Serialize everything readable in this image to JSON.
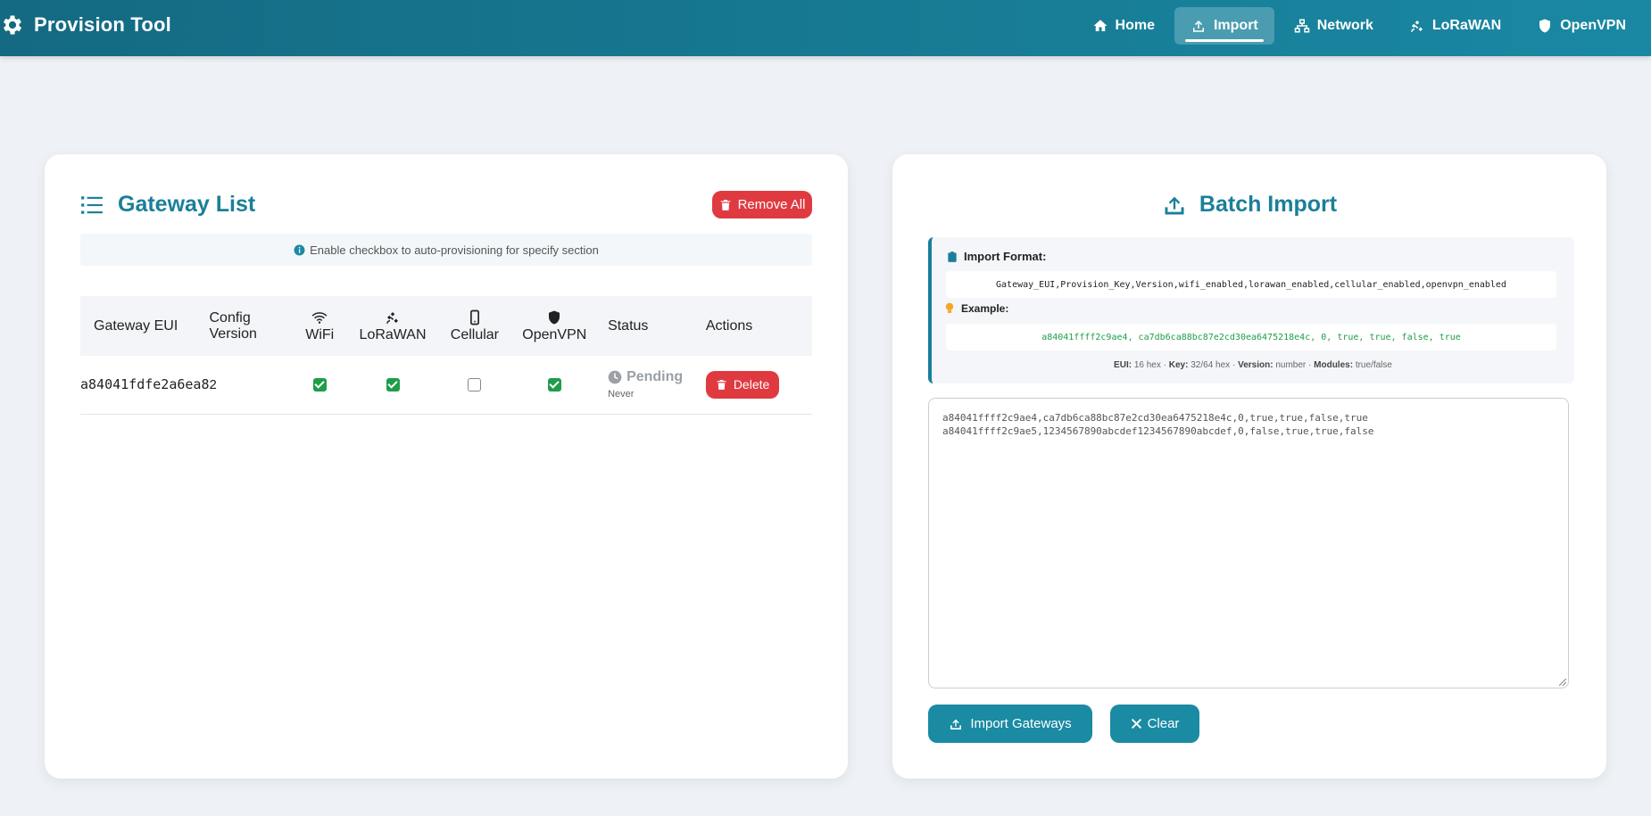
{
  "app": {
    "title": "Provision Tool"
  },
  "nav": [
    {
      "label": "Home",
      "icon": "home-icon"
    },
    {
      "label": "Import",
      "icon": "upload-icon",
      "active": true
    },
    {
      "label": "Network",
      "icon": "network-icon"
    },
    {
      "label": "LoRaWAN",
      "icon": "satellite-icon"
    },
    {
      "label": "OpenVPN",
      "icon": "shield-icon"
    }
  ],
  "gateway_list": {
    "title": "Gateway List",
    "remove_all_label": "Remove All",
    "info_text": "Enable checkbox to auto-provisioning for specify section",
    "columns": {
      "eui": "Gateway EUI",
      "config_version_line1": "Config",
      "config_version_line2": "Version",
      "wifi": "WiFi",
      "lorawan": "LoRaWAN",
      "cellular": "Cellular",
      "openvpn": "OpenVPN",
      "status": "Status",
      "actions": "Actions"
    },
    "rows": [
      {
        "eui": "a84041fdfe2a6ea8",
        "version": "2",
        "wifi": true,
        "lorawan": true,
        "cellular": false,
        "openvpn": true,
        "status": "Pending",
        "last_seen": "Never",
        "delete_label": "Delete"
      }
    ]
  },
  "batch_import": {
    "title": "Batch Import",
    "format_label": "Import Format:",
    "format_code": "Gateway_EUI,Provision_Key,Version,wifi_enabled,lorawan_enabled,cellular_enabled,openvpn_enabled",
    "example_label": "Example:",
    "example_code": "a84041ffff2c9ae4, ca7db6ca88bc87e2cd30ea6475218e4c, 0, true, true, false, true",
    "legend": {
      "eui_key": "EUI:",
      "eui_val": "16 hex",
      "key_key": "Key:",
      "key_val": "32/64 hex",
      "version_key": "Version:",
      "version_val": "number",
      "modules_key": "Modules:",
      "modules_val": "true/false",
      "sep": "·"
    },
    "textarea_lines": [
      "a84041ffff2c9ae4,ca7db6ca88bc87e2cd30ea6475218e4c,0,true,true,false,true",
      "a84041ffff2c9ae5,1234567890abcdef1234567890abcdef,0,false,true,true,false"
    ],
    "import_button_label": "Import Gateways",
    "clear_button_label": "Clear"
  },
  "colors": {
    "brand": "#1b7f9a",
    "danger": "#e03a41",
    "success": "#1f9d4a",
    "pending": "#9aa0a6"
  }
}
